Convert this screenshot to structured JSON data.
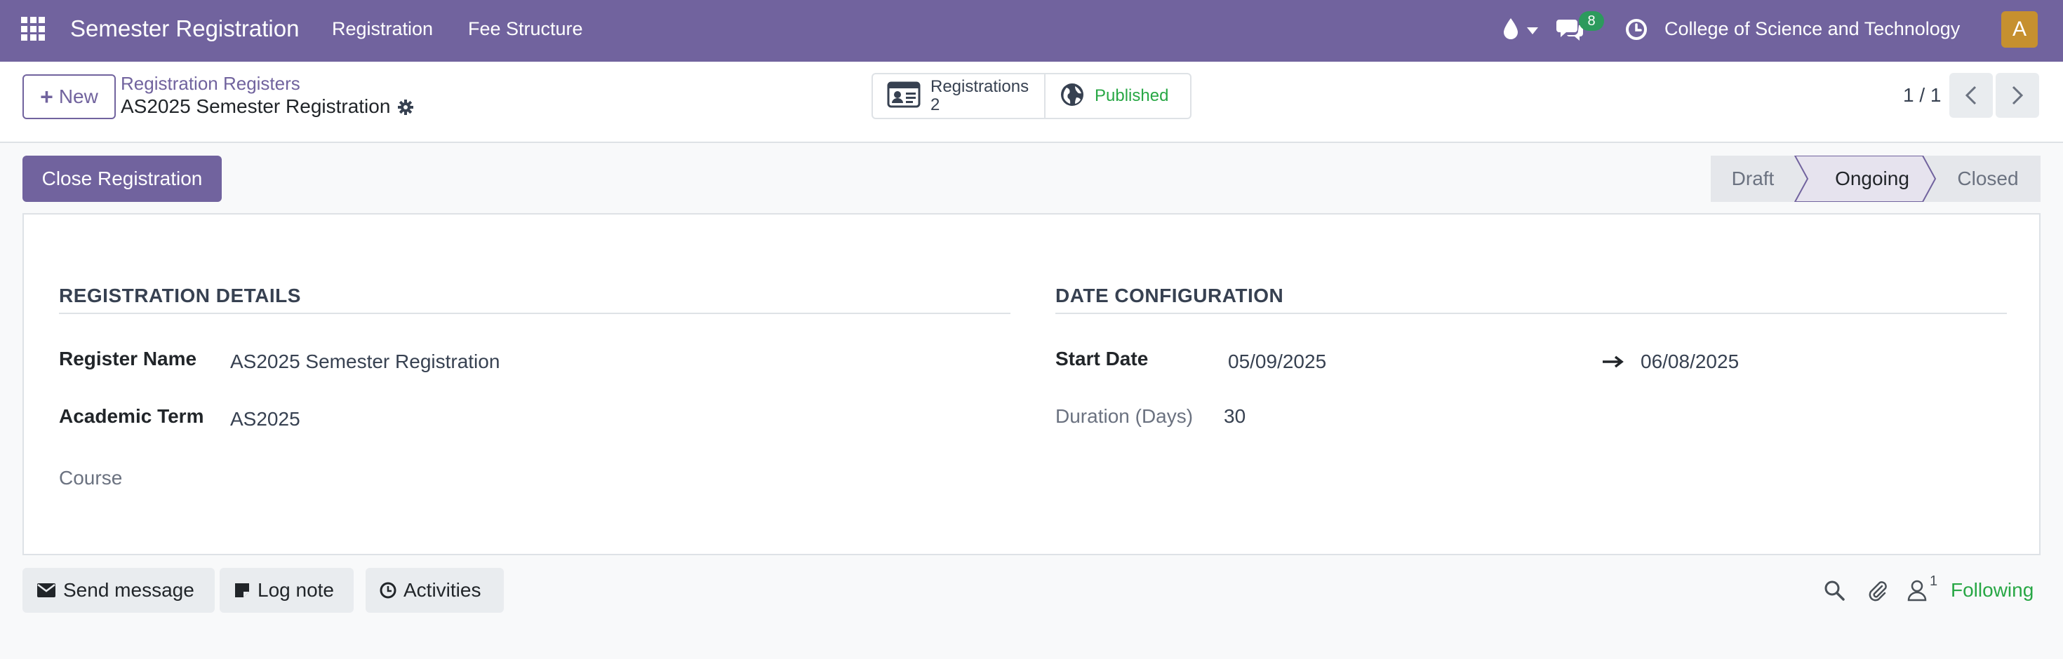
{
  "navbar": {
    "app_title": "Semester Registration",
    "menus": [
      "Registration",
      "Fee Structure"
    ],
    "messages_badge": "8",
    "company": "College of Science and Technology",
    "avatar_letter": "A",
    "icons": [
      "apps-grid-icon",
      "droplet-icon",
      "caret-down-icon",
      "chat-icon",
      "clock-icon"
    ]
  },
  "control_panel": {
    "new_label": "New",
    "breadcrumb": "Registration Registers",
    "record_title": "AS2025 Semester Registration",
    "smart_buttons": {
      "registrations_label": "Registrations",
      "registrations_count": "2",
      "published_label": "Published"
    },
    "pager": "1 / 1"
  },
  "statusbar": {
    "action_button": "Close Registration",
    "steps": [
      "Draft",
      "Ongoing",
      "Closed"
    ],
    "active_step": "Ongoing"
  },
  "form": {
    "registration_details": {
      "title": "REGISTRATION DETAILS",
      "fields": [
        {
          "label": "Register Name",
          "value": "AS2025 Semester Registration"
        },
        {
          "label": "Academic Term",
          "value": "AS2025"
        },
        {
          "label": "Course",
          "value": ""
        }
      ]
    },
    "date_configuration": {
      "title": "DATE CONFIGURATION",
      "start_date_label": "Start Date",
      "start_date": "05/09/2025",
      "end_date": "06/08/2025",
      "duration_label": "Duration (Days)",
      "duration": "30"
    }
  },
  "chatter": {
    "send_message": "Send message",
    "log_note": "Log note",
    "activities": "Activities",
    "followers_count": "1",
    "following": "Following"
  },
  "colors": {
    "brand": "#71639e",
    "success": "#28a745",
    "avatar": "#c6902f"
  }
}
